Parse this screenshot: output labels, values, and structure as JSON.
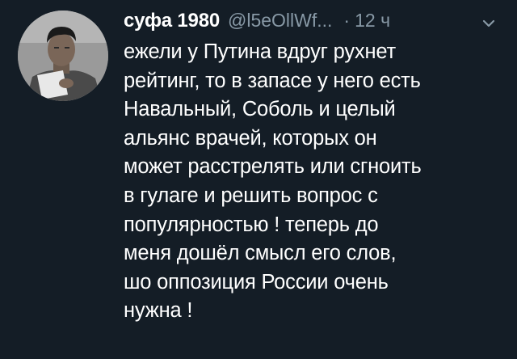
{
  "tweet": {
    "author_name": "суфа 1980",
    "author_handle": "@l5eOllWf...",
    "separator": "·",
    "timestamp": "12 ч",
    "avatar_icon": "profile-photo",
    "menu_icon": "chevron-down-icon",
    "text_lines": [
      "ежели у Путина вдруг рухнет",
      "рейтинг, то в запасе у него есть",
      "Навальный, Соболь и целый",
      "альянс врачей, которых он",
      "может расстрелять или сгноить",
      "в гулаге и решить вопрос с",
      "популярностью ! теперь до",
      "меня дошёл смысл его слов,",
      "шо оппозиция России очень",
      "нужна !"
    ]
  },
  "colors": {
    "background": "#141d26",
    "text": "#ffffff",
    "secondary": "#8899a6"
  }
}
